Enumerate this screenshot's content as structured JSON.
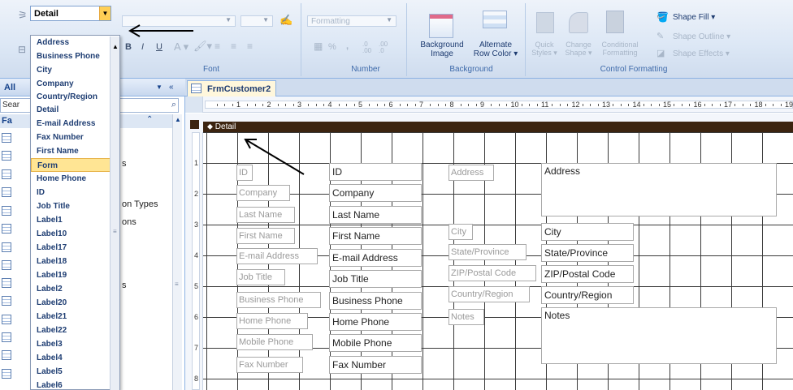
{
  "selection": {
    "value": "Detail"
  },
  "dropdown": {
    "items": [
      "Address",
      "Business Phone",
      "City",
      "Company",
      "Country/Region",
      "Detail",
      "E-mail Address",
      "Fax Number",
      "First Name",
      "Form",
      "Home Phone",
      "ID",
      "Job Title",
      "Label1",
      "Label10",
      "Label17",
      "Label18",
      "Label19",
      "Label2",
      "Label20",
      "Label21",
      "Label22",
      "Label3",
      "Label4",
      "Label5",
      "Label6"
    ],
    "selected": "Form"
  },
  "ribbon": {
    "font": {
      "label": "Font",
      "bold": "B",
      "italic": "I",
      "underline": "U"
    },
    "number": {
      "label": "Number",
      "format_placeholder": "Formatting",
      "percent": "%",
      "comma": ",",
      "inc_decimal": ".0 .00",
      "dec_decimal": ".00 .0"
    },
    "background": {
      "label": "Background",
      "bg_image": "Background Image",
      "bg_image_arrow": "Image ▾",
      "alt_color": "Alternate Row Color ▾"
    },
    "control_formatting": {
      "label": "Control Formatting",
      "quick_styles": "Quick Styles ▾",
      "change_shape": "Change Shape ▾",
      "conditional": "Conditional Formatting",
      "shape_fill": "Shape Fill ▾",
      "shape_outline": "Shape Outline ▾",
      "shape_effects": "Shape Effects ▾"
    }
  },
  "nav": {
    "header": "All",
    "search_placeholder": "Sear",
    "category": "Fa",
    "fragments": [
      "s",
      "on Types",
      "ons",
      "s"
    ]
  },
  "tab": {
    "title": "FrmCustomer2"
  },
  "section": {
    "detail": "Detail"
  },
  "ruler": {
    "top": [
      "1",
      "2",
      "3",
      "4",
      "5",
      "6",
      "7",
      "8",
      "9",
      "10",
      "11",
      "12",
      "13",
      "14",
      "15",
      "16",
      "17",
      "18",
      "19"
    ],
    "left": [
      "1",
      "2",
      "3",
      "4",
      "5",
      "6",
      "7",
      "8"
    ]
  },
  "form_controls": {
    "left_labels": [
      "ID",
      "Company",
      "Last Name",
      "First Name",
      "E-mail Address",
      "Job Title",
      "Business Phone",
      "Home Phone",
      "Mobile Phone",
      "Fax Number"
    ],
    "left_textboxes": [
      "ID",
      "Company",
      "Last Name",
      "First Name",
      "E-mail Address",
      "Job Title",
      "Business Phone",
      "Home Phone",
      "Mobile Phone",
      "Fax Number"
    ],
    "right_labels": [
      "Address",
      "City",
      "State/Province",
      "ZIP/Postal Code",
      "Country/Region",
      "Notes"
    ],
    "right_textboxes": [
      "Address",
      "City",
      "State/Province",
      "ZIP/Postal Code",
      "Country/Region",
      "Notes"
    ]
  },
  "colors": {
    "ribbon_bg": "#dce7f5",
    "detail_band": "#3c2410",
    "selected_highlight": "#ffe594",
    "combo_arrow": "#ffcf55"
  }
}
